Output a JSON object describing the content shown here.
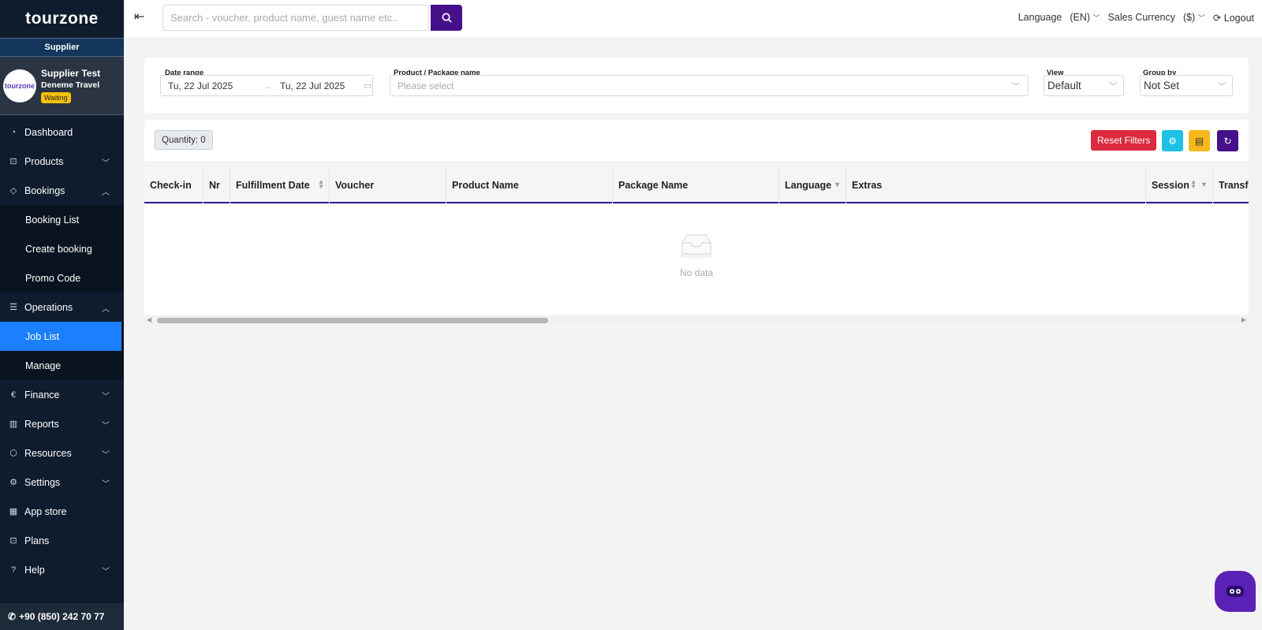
{
  "sidebar": {
    "logo": "tourzone",
    "role": "Supplier",
    "profile": {
      "avatar_text": "tourzone",
      "name": "Supplier Test",
      "company": "Deneme Travel",
      "status": "Waiting"
    },
    "items": [
      {
        "label": "Dashboard",
        "icon": "dashboard-icon"
      },
      {
        "label": "Products",
        "icon": "bag-icon"
      },
      {
        "label": "Bookings",
        "icon": "tag-icon"
      },
      {
        "label": "Booking List"
      },
      {
        "label": "Create booking"
      },
      {
        "label": "Promo Code"
      },
      {
        "label": "Operations",
        "icon": "list-icon"
      },
      {
        "label": "Job List"
      },
      {
        "label": "Manage"
      },
      {
        "label": "Finance",
        "icon": "euro-icon"
      },
      {
        "label": "Reports",
        "icon": "bar-chart-icon"
      },
      {
        "label": "Resources",
        "icon": "cube-icon"
      },
      {
        "label": "Settings",
        "icon": "gear-icon"
      },
      {
        "label": "App store",
        "icon": "grid-icon"
      },
      {
        "label": "Plans",
        "icon": "bag-icon"
      },
      {
        "label": "Help",
        "icon": "help-icon"
      }
    ],
    "phone": "+90 (850) 242 70 77"
  },
  "header": {
    "search_placeholder": "Search - voucher, product name, guest name etc..",
    "language_label": "Language",
    "language_value": "(EN)",
    "currency_label": "Sales Currency",
    "currency_value": "($)",
    "logout": "Logout"
  },
  "filters": {
    "date_range_label": "Date range",
    "date_from": "Tu, 22 Jul 2025",
    "date_to": "Tu, 22 Jul 2025",
    "product_label": "Product / Package name",
    "product_placeholder": "Please select",
    "view_label": "View",
    "view_value": "Default",
    "group_label": "Group by",
    "group_value": "Not Set"
  },
  "toolbar": {
    "quantity": "Quantity: 0",
    "reset": "Reset Filters"
  },
  "table": {
    "columns": [
      "Check-in",
      "Nr",
      "Fulfillment Date",
      "Voucher",
      "Product Name",
      "Package Name",
      "Language",
      "Extras",
      "Session",
      "Transfe"
    ],
    "empty_text": "No data"
  },
  "colors": {
    "sidebar_bg": "#0f1c2e",
    "active_item": "#1b7fff",
    "primary": "#45108a",
    "reset": "#dc2b3e",
    "settings_btn": "#1ec0e6",
    "export_btn": "#f5b81c"
  }
}
